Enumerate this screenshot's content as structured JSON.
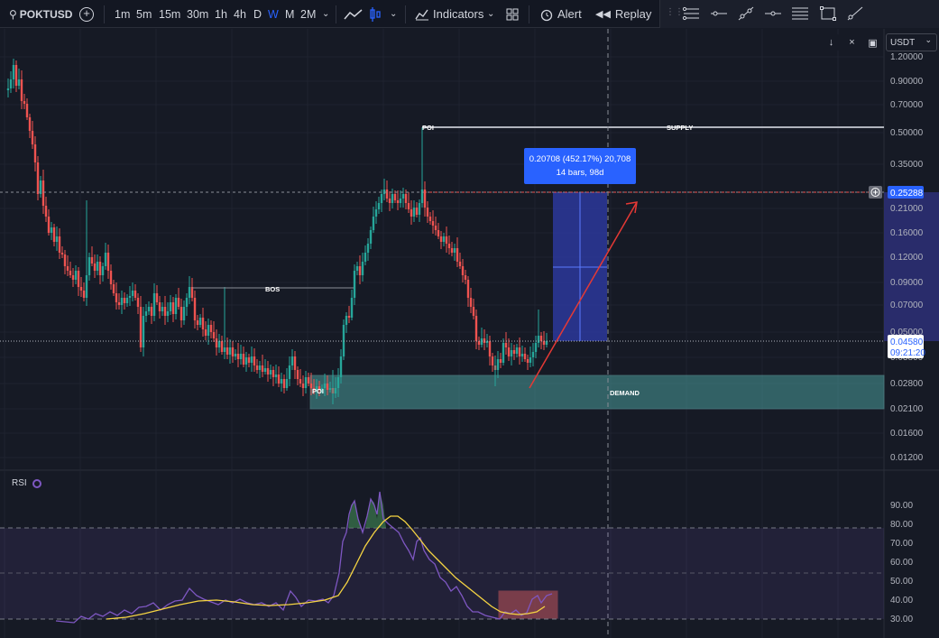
{
  "toolbar": {
    "symbol": "POKTUSD",
    "timeframes": [
      "1m",
      "5m",
      "15m",
      "30m",
      "1h",
      "4h",
      "D",
      "W",
      "M",
      "2M"
    ],
    "active_timeframe": "W",
    "indicators_label": "Indicators",
    "alert_label": "Alert",
    "replay_label": "Replay"
  },
  "currency_select": "USDT",
  "price_axis": {
    "labels": [
      "1.20000",
      "0.90000",
      "0.70000",
      "0.50000",
      "0.35000",
      "0.21000",
      "0.16000",
      "0.12000",
      "0.09000",
      "0.07000",
      "0.05000",
      "0.03800",
      "0.02800",
      "0.02100",
      "0.01600",
      "0.01200"
    ],
    "current_price": "0.04580",
    "countdown": "09:21:20",
    "target_price": "0.25288"
  },
  "rsi_axis": {
    "labels": [
      "90.00",
      "80.00",
      "70.00",
      "60.00",
      "50.00",
      "40.00",
      "30.00"
    ]
  },
  "annotations": {
    "poi_top": "POI",
    "supply": "SUPPLY",
    "bos": "BOS",
    "poi_bottom": "POI",
    "demand": "DEMAND"
  },
  "measure": {
    "line1": "0.20708 (452.17%) 20,708",
    "line2": "14 bars, 98d"
  },
  "rsi_title": "RSI",
  "colors": {
    "background": "#161a25",
    "up": "#26a69a",
    "down": "#ef5350",
    "accent": "#2962ff",
    "rsi_line": "#7e57c2",
    "rsi_ma": "#f5d442",
    "demand_zone": "#4a9b9b"
  }
}
